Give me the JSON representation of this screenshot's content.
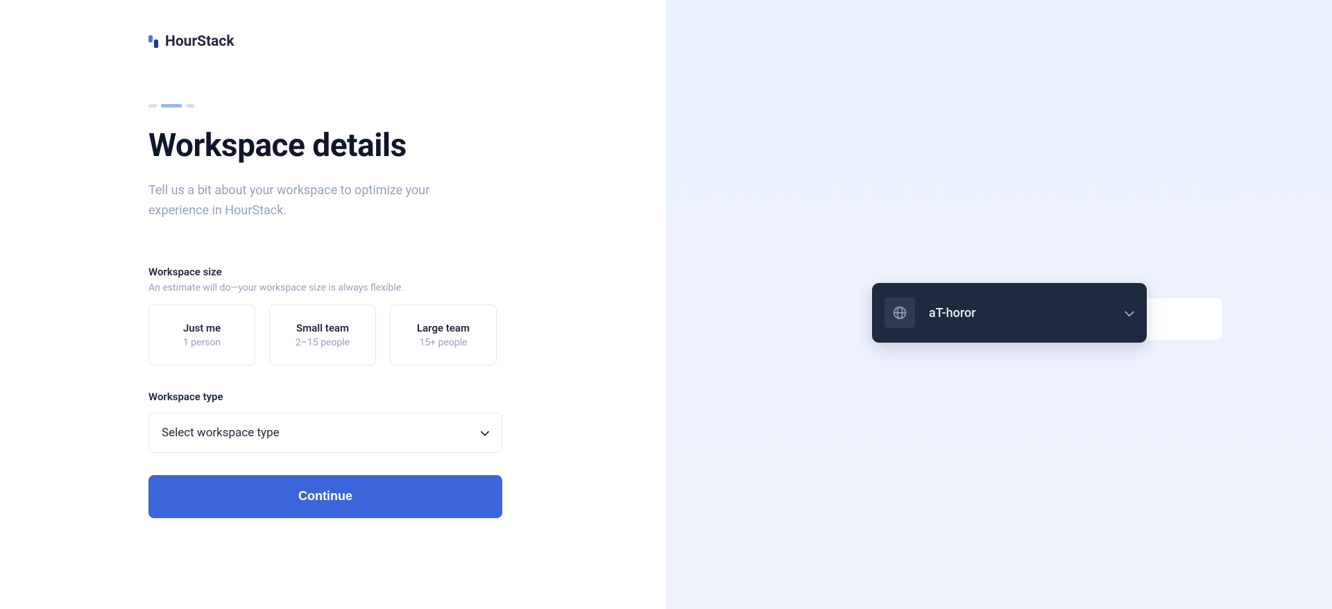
{
  "brand": {
    "name": "HourStack"
  },
  "page": {
    "title": "Workspace details",
    "description": "Tell us a bit about your workspace to optimize your experience in HourStack."
  },
  "workspace_size": {
    "label": "Workspace size",
    "help": "An estimate will do—your workspace size is always flexible.",
    "options": [
      {
        "title": "Just me",
        "sub": "1 person"
      },
      {
        "title": "Small team",
        "sub": "2–15 people"
      },
      {
        "title": "Large team",
        "sub": "15+ people"
      }
    ]
  },
  "workspace_type": {
    "label": "Workspace type",
    "placeholder": "Select workspace type"
  },
  "actions": {
    "continue": "Continue"
  },
  "preview": {
    "workspace_name": "aT-horor"
  }
}
